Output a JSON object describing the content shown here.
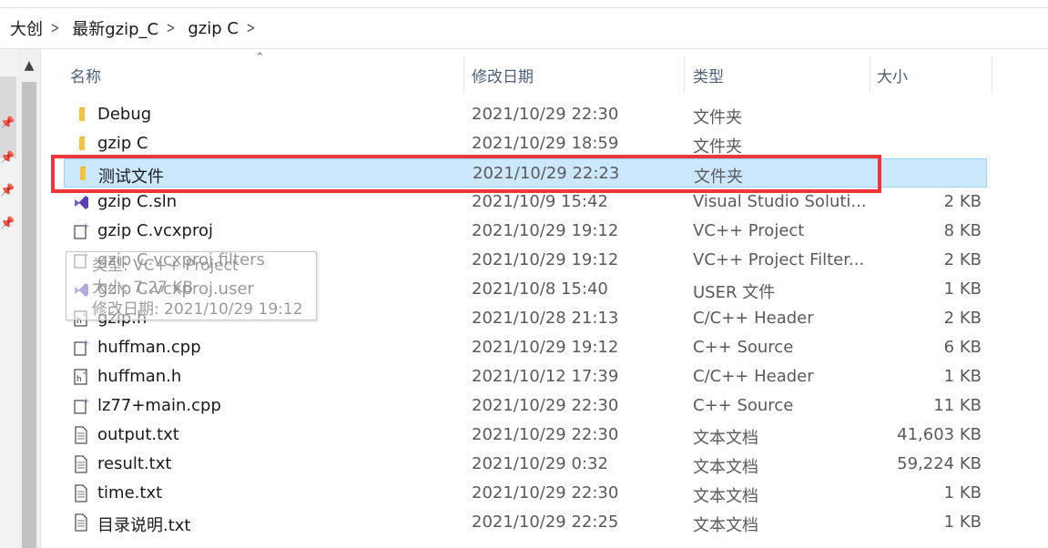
{
  "breadcrumb": [
    "大创",
    "最新gzip_C",
    "gzip C"
  ],
  "columns": {
    "name": "名称",
    "date": "修改日期",
    "type": "类型",
    "size": "大小"
  },
  "files": [
    {
      "name": "Debug",
      "date": "2021/10/29 22:30",
      "type": "文件夹",
      "size": "",
      "icon": "folder-icon"
    },
    {
      "name": "gzip C",
      "date": "2021/10/29 18:59",
      "type": "文件夹",
      "size": "",
      "icon": "folder-icon"
    },
    {
      "name": "测试文件",
      "date": "2021/10/29 22:23",
      "type": "文件夹",
      "size": "",
      "icon": "folder-icon",
      "selected": true
    },
    {
      "name": "gzip C.sln",
      "date": "2021/10/9 15:42",
      "type": "Visual Studio Soluti...",
      "size": "2 KB",
      "icon": "vs-solution-icon"
    },
    {
      "name": "gzip C.vcxproj",
      "date": "2021/10/29 19:12",
      "type": "VC++ Project",
      "size": "8 KB",
      "icon": "vcxproj-icon"
    },
    {
      "name": "gzip C.vcxproj.filters",
      "date": "2021/10/29 19:12",
      "type": "VC++ Project Filter...",
      "size": "2 KB",
      "icon": "filters-icon"
    },
    {
      "name": "gzip C.vcxproj.user",
      "date": "2021/10/8 15:40",
      "type": "USER 文件",
      "size": "1 KB",
      "icon": "vs-user-icon"
    },
    {
      "name": "gzip.h",
      "date": "2021/10/28 21:13",
      "type": "C/C++ Header",
      "size": "2 KB",
      "icon": "header-file-icon"
    },
    {
      "name": "huffman.cpp",
      "date": "2021/10/29 19:12",
      "type": "C++ Source",
      "size": "6 KB",
      "icon": "cpp-file-icon"
    },
    {
      "name": "huffman.h",
      "date": "2021/10/12 17:39",
      "type": "C/C++ Header",
      "size": "1 KB",
      "icon": "header-file-icon"
    },
    {
      "name": "lz77+main.cpp",
      "date": "2021/10/29 22:30",
      "type": "C++ Source",
      "size": "11 KB",
      "icon": "cpp-file-icon"
    },
    {
      "name": "output.txt",
      "date": "2021/10/29 22:30",
      "type": "文本文档",
      "size": "41,603 KB",
      "icon": "text-file-icon"
    },
    {
      "name": "result.txt",
      "date": "2021/10/29 0:32",
      "type": "文本文档",
      "size": "59,224 KB",
      "icon": "text-file-icon"
    },
    {
      "name": "time.txt",
      "date": "2021/10/29 22:30",
      "type": "文本文档",
      "size": "1 KB",
      "icon": "text-file-icon"
    },
    {
      "name": "目录说明.txt",
      "date": "2021/10/29 22:25",
      "type": "文本文档",
      "size": "1 KB",
      "icon": "text-file-icon"
    }
  ],
  "tooltip": {
    "type_line": "类型: VC++ Project",
    "size_line": "大小: 7.27 KB",
    "date_line": "修改日期: 2021/10/29 19:12"
  },
  "colors": {
    "selection": "#cce8ff",
    "highlight": "#f0353a",
    "folder": "#f5c342",
    "header_text": "#4c607a"
  }
}
